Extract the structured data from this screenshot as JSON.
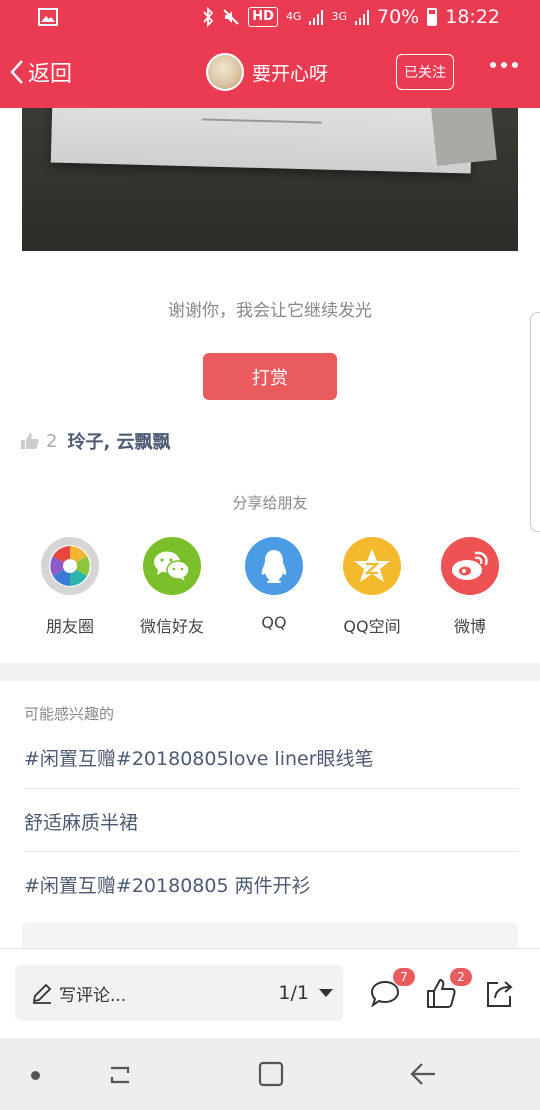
{
  "status_bar": {
    "network_hd": "HD",
    "signal_1": "4G",
    "signal_2": "3G",
    "battery": "70%",
    "time": "18:22"
  },
  "nav": {
    "back_label": "返回",
    "author_name": "要开心呀",
    "follow_label": "已关注"
  },
  "post": {
    "thanks_text": "谢谢你，我会让它继续发光",
    "reward_label": "打赏",
    "like_count": "2",
    "liked_by": "玲子, 云飘飘"
  },
  "share": {
    "title": "分享给朋友",
    "targets": [
      {
        "label": "朋友圈",
        "icon": "moments-icon",
        "color": "#d5d5d5"
      },
      {
        "label": "微信好友",
        "icon": "wechat-icon",
        "color": "#7bbf2a"
      },
      {
        "label": "QQ",
        "icon": "qq-icon",
        "color": "#4c9be5"
      },
      {
        "label": "QQ空间",
        "icon": "qzone-icon",
        "color": "#f5b92e"
      },
      {
        "label": "微博",
        "icon": "weibo-icon",
        "color": "#ee5253"
      }
    ]
  },
  "recommend": {
    "title": "可能感兴趣的",
    "items": [
      "#闲置互赠#20180805love liner眼线笔",
      "舒适麻质半裙",
      "#闲置互赠#20180805 两件开衫"
    ]
  },
  "comment_bar": {
    "placeholder": "写评论...",
    "page_indicator": "1/1",
    "comment_count": "7",
    "like_count": "2"
  },
  "colors": {
    "brand": "#ea3b52",
    "reward": "#ea5b5e",
    "link": "#4d5a73"
  }
}
